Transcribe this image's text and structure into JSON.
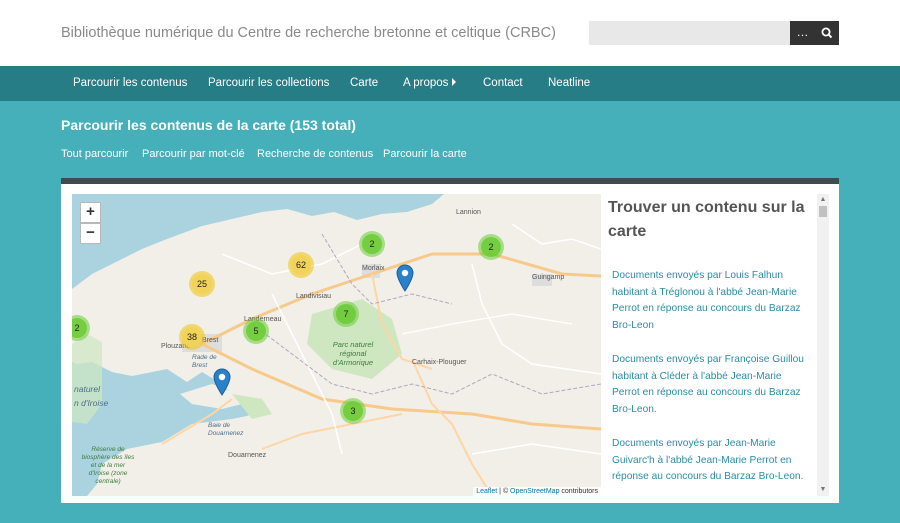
{
  "header": {
    "site_title": "Bibliothèque numérique du Centre de recherche bretonne et celtique (CRBC)",
    "search_placeholder": "",
    "search_more_label": "…",
    "search_icon": "magnifier-icon"
  },
  "nav": {
    "items": [
      "Parcourir les contenus",
      "Parcourir les collections",
      "Carte",
      "A propos",
      "Contact",
      "Neatline"
    ]
  },
  "page": {
    "title": "Parcourir les contenus de la carte (153 total)",
    "subnav": [
      "Tout parcourir",
      "Parcourir par mot-clé",
      "Recherche de contenus",
      "Parcourir la carte"
    ]
  },
  "map": {
    "zoom_in": "+",
    "zoom_out": "−",
    "clusters": [
      {
        "count": "2",
        "color": "green"
      },
      {
        "count": "2",
        "color": "green"
      },
      {
        "count": "62",
        "color": "yellow"
      },
      {
        "count": "25",
        "color": "yellow"
      },
      {
        "count": "7",
        "color": "green"
      },
      {
        "count": "5",
        "color": "green"
      },
      {
        "count": "38",
        "color": "yellow"
      },
      {
        "count": "2",
        "color": "green"
      },
      {
        "count": "3",
        "color": "green"
      }
    ],
    "place_labels": [
      "Lannion",
      "Morlaix",
      "Guingamp",
      "Landivisiau",
      "Landerneau",
      "Plouzané",
      "Brest",
      "Carhaix-Plouguer",
      "Douarnenez"
    ],
    "sea_labels": [
      "naturel",
      "n d'Iroise"
    ],
    "park_label": "Parc naturel régional d'Armorique",
    "bay_labels": [
      "Rade de Brest",
      "Baie de Douarnenez"
    ],
    "reserve_label": "Réserve de biosphère des îles et de la mer d'Iroise (zone centrale)",
    "attribution": {
      "leaflet": "Leaflet",
      "separator": " | © ",
      "osm": "OpenStreetMap",
      "suffix": " contributors"
    }
  },
  "sidebar": {
    "title": "Trouver un contenu sur la carte",
    "results": [
      "Documents envoyés par Louis Falhun habitant à Tréglonou à l'abbé Jean-Marie Perrot en réponse au concours du Barzaz Bro-Leon",
      "Documents envoyés par Françoise Guillou habitant à Cléder à l'abbé Jean-Marie Perrot en réponse au concours du Barzaz Bro-Leon.",
      "Documents envoyés par Jean-Marie Guivarc'h à l'abbé Jean-Marie Perrot en réponse au concours du Barzaz Bro-Leon."
    ]
  },
  "colors": {
    "header_bg": "#ffffff",
    "nav_bg": "#267d86",
    "page_bg": "#45b0ba",
    "link": "#2a8ea6",
    "cluster_green": "#6ecc39",
    "cluster_yellow": "#f0c20c",
    "marker": "#2a81cb"
  }
}
